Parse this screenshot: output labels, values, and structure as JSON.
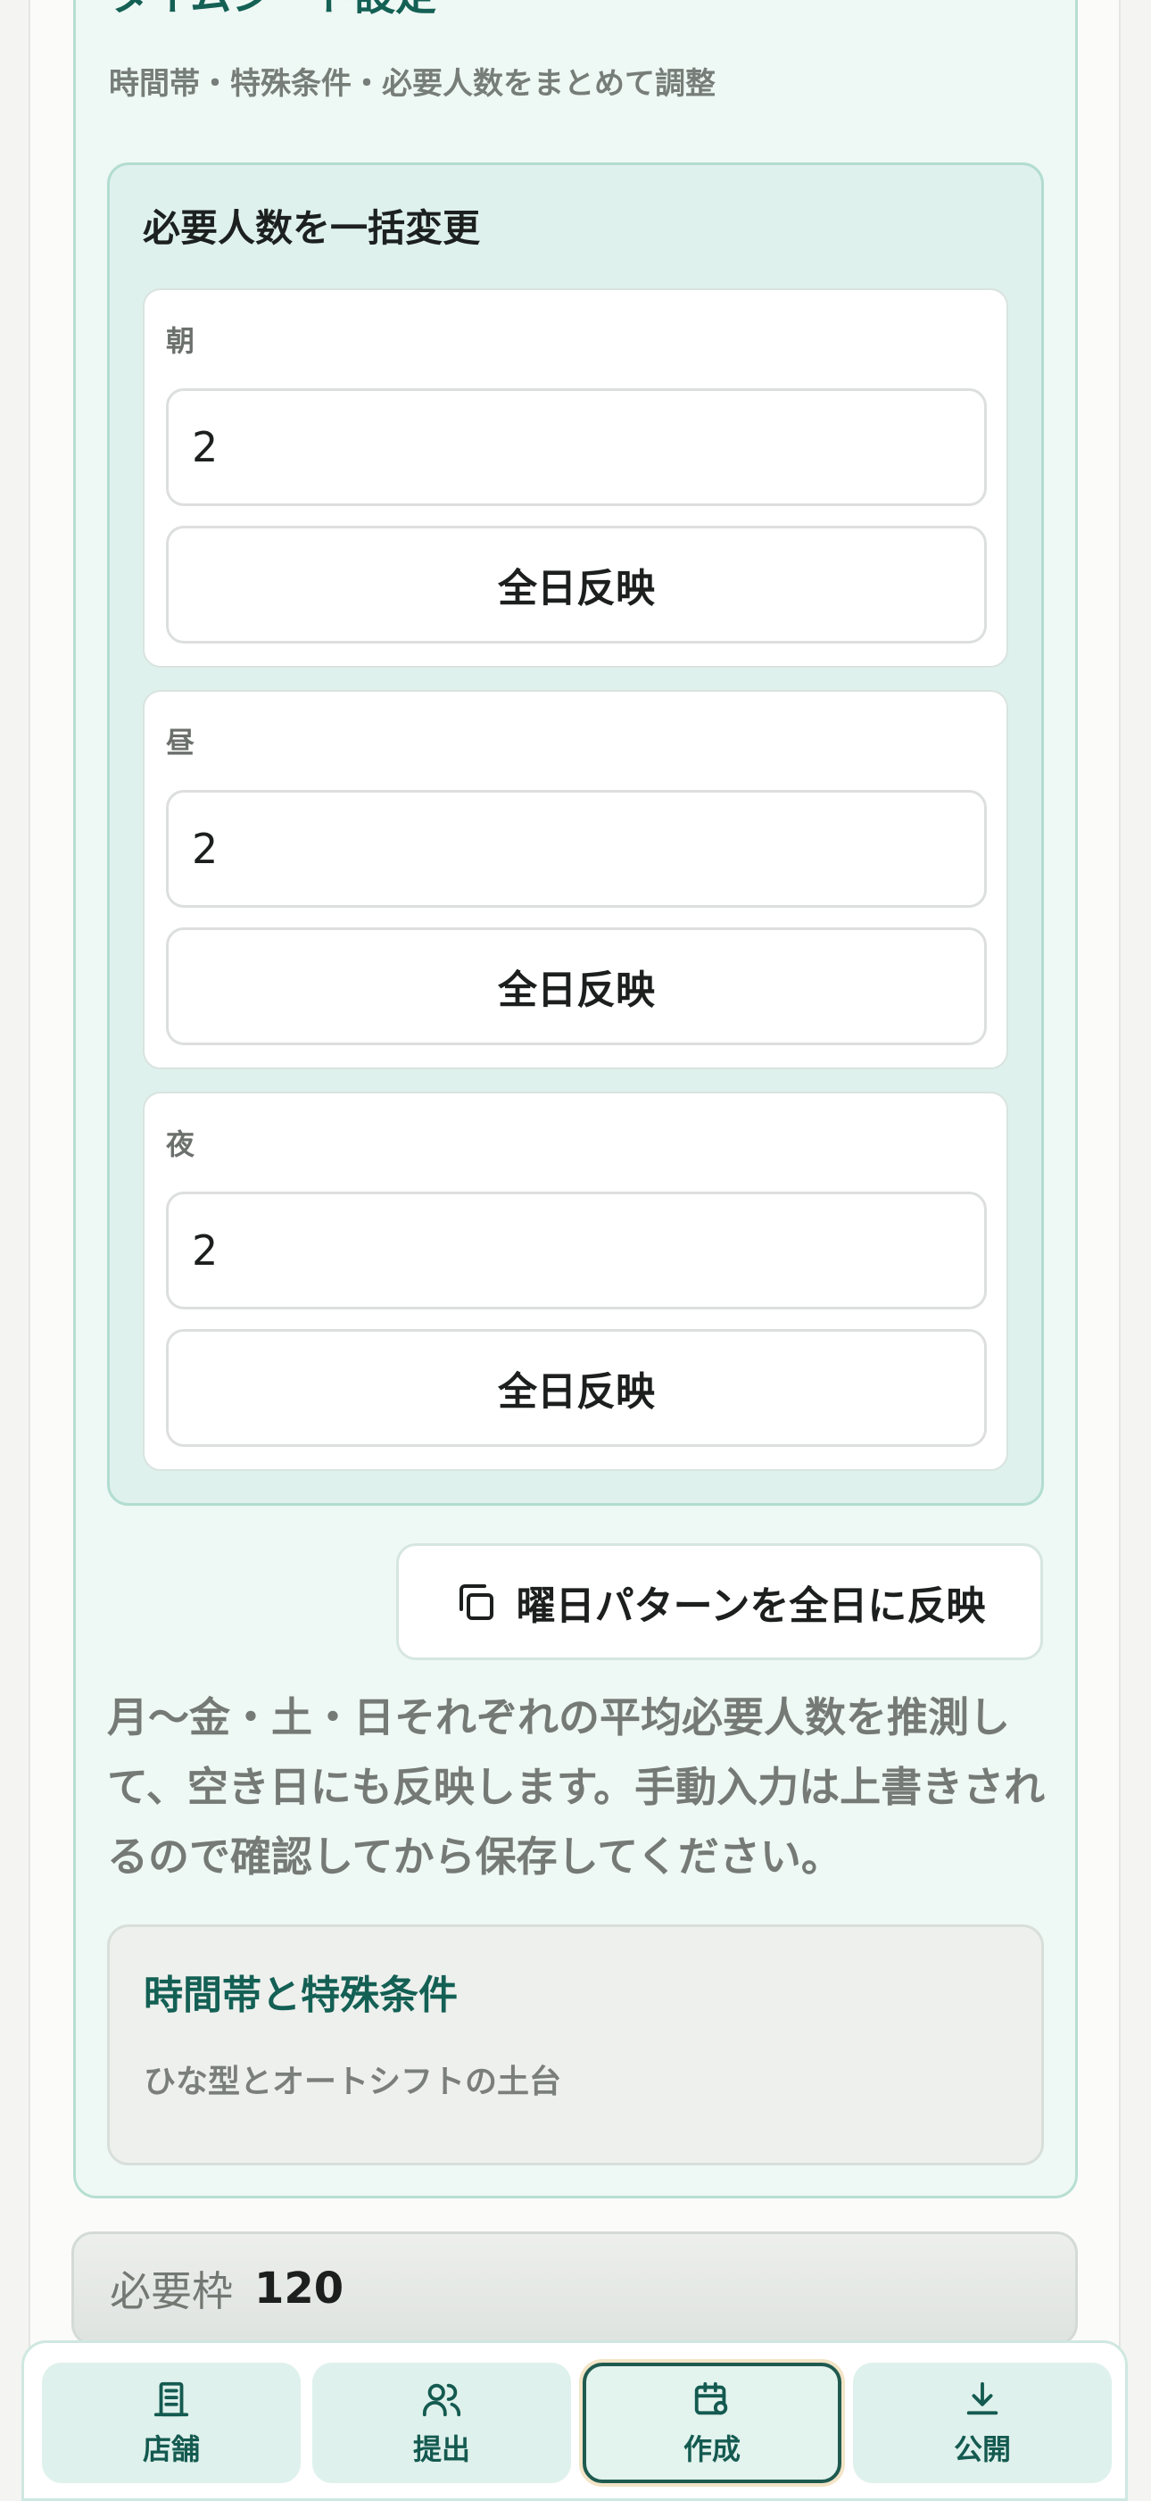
{
  "section": {
    "title": "タイムシート設定",
    "subtitle": "時間帯・特殊条件・必要人数をまとめて調整"
  },
  "bulk": {
    "title": "必要人数を一括変更",
    "slots": [
      {
        "label": "朝",
        "value": "2",
        "button": "全日反映"
      },
      {
        "label": "昼",
        "value": "2",
        "button": "全日反映"
      },
      {
        "label": "夜",
        "value": "2",
        "button": "全日反映"
      }
    ]
  },
  "pattern_button": {
    "label": "曜日パターンを全日に反映",
    "icon": "copy-icon"
  },
  "description": "月〜金・土・日それぞれの平均必要人数を推測して、空き日にも反映します。手動入力は上書きされるので確認してから保存してください。",
  "conditions": {
    "title": "時間帯と特殊条件",
    "subtitle": "ひな型とオートシフトの土台"
  },
  "required": {
    "label": "必要枠",
    "value": "120"
  },
  "nav": {
    "items": [
      {
        "label": "店舗",
        "icon": "store-icon"
      },
      {
        "label": "提出",
        "icon": "users-icon"
      },
      {
        "label": "作成",
        "icon": "calendar-settings-icon",
        "active": true
      },
      {
        "label": "公開",
        "icon": "download-icon"
      }
    ]
  },
  "colors": {
    "accent": "#146055",
    "panel": "#dff1ec",
    "card_bg": "#eef8f4"
  }
}
